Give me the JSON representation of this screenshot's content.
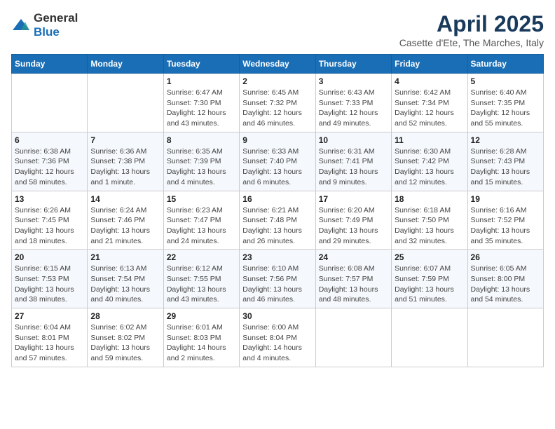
{
  "logo": {
    "general": "General",
    "blue": "Blue"
  },
  "title": "April 2025",
  "subtitle": "Casette d'Ete, The Marches, Italy",
  "days_of_week": [
    "Sunday",
    "Monday",
    "Tuesday",
    "Wednesday",
    "Thursday",
    "Friday",
    "Saturday"
  ],
  "weeks": [
    [
      {
        "day": "",
        "sunrise": "",
        "sunset": "",
        "daylight": ""
      },
      {
        "day": "",
        "sunrise": "",
        "sunset": "",
        "daylight": ""
      },
      {
        "day": "1",
        "sunrise": "Sunrise: 6:47 AM",
        "sunset": "Sunset: 7:30 PM",
        "daylight": "Daylight: 12 hours and 43 minutes."
      },
      {
        "day": "2",
        "sunrise": "Sunrise: 6:45 AM",
        "sunset": "Sunset: 7:32 PM",
        "daylight": "Daylight: 12 hours and 46 minutes."
      },
      {
        "day": "3",
        "sunrise": "Sunrise: 6:43 AM",
        "sunset": "Sunset: 7:33 PM",
        "daylight": "Daylight: 12 hours and 49 minutes."
      },
      {
        "day": "4",
        "sunrise": "Sunrise: 6:42 AM",
        "sunset": "Sunset: 7:34 PM",
        "daylight": "Daylight: 12 hours and 52 minutes."
      },
      {
        "day": "5",
        "sunrise": "Sunrise: 6:40 AM",
        "sunset": "Sunset: 7:35 PM",
        "daylight": "Daylight: 12 hours and 55 minutes."
      }
    ],
    [
      {
        "day": "6",
        "sunrise": "Sunrise: 6:38 AM",
        "sunset": "Sunset: 7:36 PM",
        "daylight": "Daylight: 12 hours and 58 minutes."
      },
      {
        "day": "7",
        "sunrise": "Sunrise: 6:36 AM",
        "sunset": "Sunset: 7:38 PM",
        "daylight": "Daylight: 13 hours and 1 minute."
      },
      {
        "day": "8",
        "sunrise": "Sunrise: 6:35 AM",
        "sunset": "Sunset: 7:39 PM",
        "daylight": "Daylight: 13 hours and 4 minutes."
      },
      {
        "day": "9",
        "sunrise": "Sunrise: 6:33 AM",
        "sunset": "Sunset: 7:40 PM",
        "daylight": "Daylight: 13 hours and 6 minutes."
      },
      {
        "day": "10",
        "sunrise": "Sunrise: 6:31 AM",
        "sunset": "Sunset: 7:41 PM",
        "daylight": "Daylight: 13 hours and 9 minutes."
      },
      {
        "day": "11",
        "sunrise": "Sunrise: 6:30 AM",
        "sunset": "Sunset: 7:42 PM",
        "daylight": "Daylight: 13 hours and 12 minutes."
      },
      {
        "day": "12",
        "sunrise": "Sunrise: 6:28 AM",
        "sunset": "Sunset: 7:43 PM",
        "daylight": "Daylight: 13 hours and 15 minutes."
      }
    ],
    [
      {
        "day": "13",
        "sunrise": "Sunrise: 6:26 AM",
        "sunset": "Sunset: 7:45 PM",
        "daylight": "Daylight: 13 hours and 18 minutes."
      },
      {
        "day": "14",
        "sunrise": "Sunrise: 6:24 AM",
        "sunset": "Sunset: 7:46 PM",
        "daylight": "Daylight: 13 hours and 21 minutes."
      },
      {
        "day": "15",
        "sunrise": "Sunrise: 6:23 AM",
        "sunset": "Sunset: 7:47 PM",
        "daylight": "Daylight: 13 hours and 24 minutes."
      },
      {
        "day": "16",
        "sunrise": "Sunrise: 6:21 AM",
        "sunset": "Sunset: 7:48 PM",
        "daylight": "Daylight: 13 hours and 26 minutes."
      },
      {
        "day": "17",
        "sunrise": "Sunrise: 6:20 AM",
        "sunset": "Sunset: 7:49 PM",
        "daylight": "Daylight: 13 hours and 29 minutes."
      },
      {
        "day": "18",
        "sunrise": "Sunrise: 6:18 AM",
        "sunset": "Sunset: 7:50 PM",
        "daylight": "Daylight: 13 hours and 32 minutes."
      },
      {
        "day": "19",
        "sunrise": "Sunrise: 6:16 AM",
        "sunset": "Sunset: 7:52 PM",
        "daylight": "Daylight: 13 hours and 35 minutes."
      }
    ],
    [
      {
        "day": "20",
        "sunrise": "Sunrise: 6:15 AM",
        "sunset": "Sunset: 7:53 PM",
        "daylight": "Daylight: 13 hours and 38 minutes."
      },
      {
        "day": "21",
        "sunrise": "Sunrise: 6:13 AM",
        "sunset": "Sunset: 7:54 PM",
        "daylight": "Daylight: 13 hours and 40 minutes."
      },
      {
        "day": "22",
        "sunrise": "Sunrise: 6:12 AM",
        "sunset": "Sunset: 7:55 PM",
        "daylight": "Daylight: 13 hours and 43 minutes."
      },
      {
        "day": "23",
        "sunrise": "Sunrise: 6:10 AM",
        "sunset": "Sunset: 7:56 PM",
        "daylight": "Daylight: 13 hours and 46 minutes."
      },
      {
        "day": "24",
        "sunrise": "Sunrise: 6:08 AM",
        "sunset": "Sunset: 7:57 PM",
        "daylight": "Daylight: 13 hours and 48 minutes."
      },
      {
        "day": "25",
        "sunrise": "Sunrise: 6:07 AM",
        "sunset": "Sunset: 7:59 PM",
        "daylight": "Daylight: 13 hours and 51 minutes."
      },
      {
        "day": "26",
        "sunrise": "Sunrise: 6:05 AM",
        "sunset": "Sunset: 8:00 PM",
        "daylight": "Daylight: 13 hours and 54 minutes."
      }
    ],
    [
      {
        "day": "27",
        "sunrise": "Sunrise: 6:04 AM",
        "sunset": "Sunset: 8:01 PM",
        "daylight": "Daylight: 13 hours and 57 minutes."
      },
      {
        "day": "28",
        "sunrise": "Sunrise: 6:02 AM",
        "sunset": "Sunset: 8:02 PM",
        "daylight": "Daylight: 13 hours and 59 minutes."
      },
      {
        "day": "29",
        "sunrise": "Sunrise: 6:01 AM",
        "sunset": "Sunset: 8:03 PM",
        "daylight": "Daylight: 14 hours and 2 minutes."
      },
      {
        "day": "30",
        "sunrise": "Sunrise: 6:00 AM",
        "sunset": "Sunset: 8:04 PM",
        "daylight": "Daylight: 14 hours and 4 minutes."
      },
      {
        "day": "",
        "sunrise": "",
        "sunset": "",
        "daylight": ""
      },
      {
        "day": "",
        "sunrise": "",
        "sunset": "",
        "daylight": ""
      },
      {
        "day": "",
        "sunrise": "",
        "sunset": "",
        "daylight": ""
      }
    ]
  ]
}
